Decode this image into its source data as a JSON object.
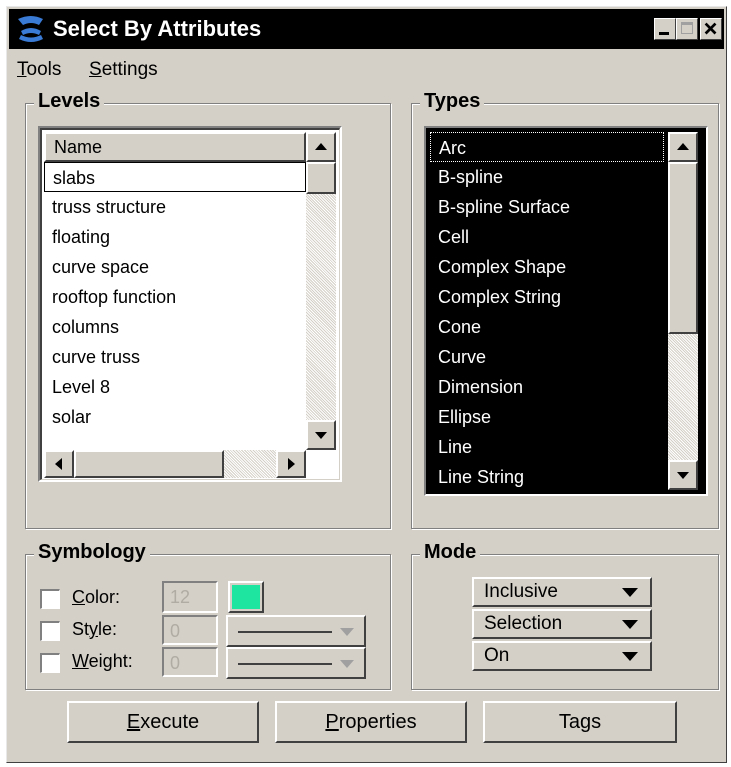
{
  "window": {
    "title": "Select By Attributes",
    "title_bar_color": "#000000"
  },
  "menu": {
    "tools": {
      "mnemonic": "T",
      "rest": "ools"
    },
    "settings": {
      "mnemonic": "S",
      "rest": "ettings"
    }
  },
  "levels": {
    "group_label": "Levels",
    "column_header": "Name",
    "items": [
      "slabs",
      "truss structure",
      "floating",
      "curve space",
      "rooftop function",
      "columns",
      "curve truss",
      "Level 8",
      "solar"
    ],
    "selected_index": 0
  },
  "types": {
    "group_label": "Types",
    "items": [
      "Arc",
      "B-spline",
      "B-spline Surface",
      "Cell",
      "Complex Shape",
      "Complex String",
      "Cone",
      "Curve",
      "Dimension",
      "Ellipse",
      "Line",
      "Line String"
    ],
    "focused_index": 0
  },
  "symbology": {
    "group_label": "Symbology",
    "color": {
      "mnemonic": "C",
      "rest": "olor:",
      "value": "12",
      "swatch": "#1ee6a0"
    },
    "style": {
      "pre": "St",
      "mnemonic": "y",
      "rest": "le:",
      "value": "0"
    },
    "weight": {
      "mnemonic": "W",
      "rest": "eight:",
      "value": "0"
    }
  },
  "mode": {
    "group_label": "Mode",
    "options": [
      "Inclusive",
      "Selection",
      "On"
    ]
  },
  "buttons": {
    "execute": {
      "mnemonic": "E",
      "rest": "xecute"
    },
    "properties": {
      "mnemonic": "P",
      "rest": "roperties"
    },
    "tags": {
      "pre": "Ta",
      "mnemonic": "g",
      "rest": "s"
    }
  }
}
